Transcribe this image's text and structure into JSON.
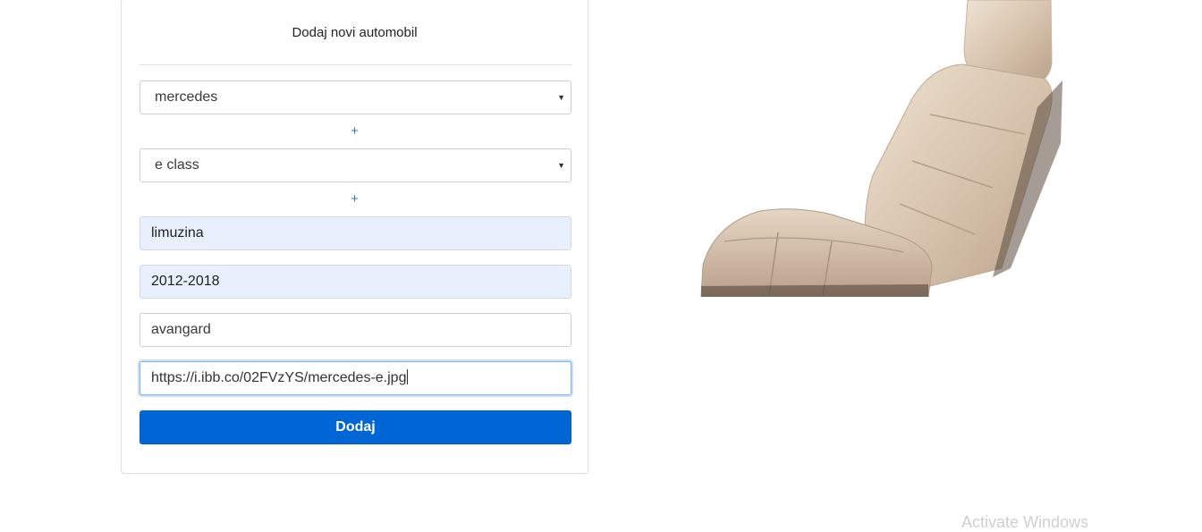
{
  "form": {
    "title": "Dodaj novi automobil",
    "brand_select": {
      "value": "mercedes"
    },
    "add_brand_label": "+",
    "model_select": {
      "value": "e class"
    },
    "add_model_label": "+",
    "body_type_input": {
      "value": "limuzina"
    },
    "years_input": {
      "value": "2012-2018"
    },
    "trim_input": {
      "value": "avangard"
    },
    "image_url_input": {
      "value": "https://i.ibb.co/02FVzYS/mercedes-e.jpg"
    },
    "submit_label": "Dodaj"
  },
  "preview": {
    "image_subject": "car seat"
  },
  "watermark": {
    "text": "Activate Windows"
  },
  "colors": {
    "primary": "#0066d6",
    "autofill_bg": "#e8f0fe",
    "link": "#2478d4",
    "seat_leather": "#d7c3ad"
  }
}
